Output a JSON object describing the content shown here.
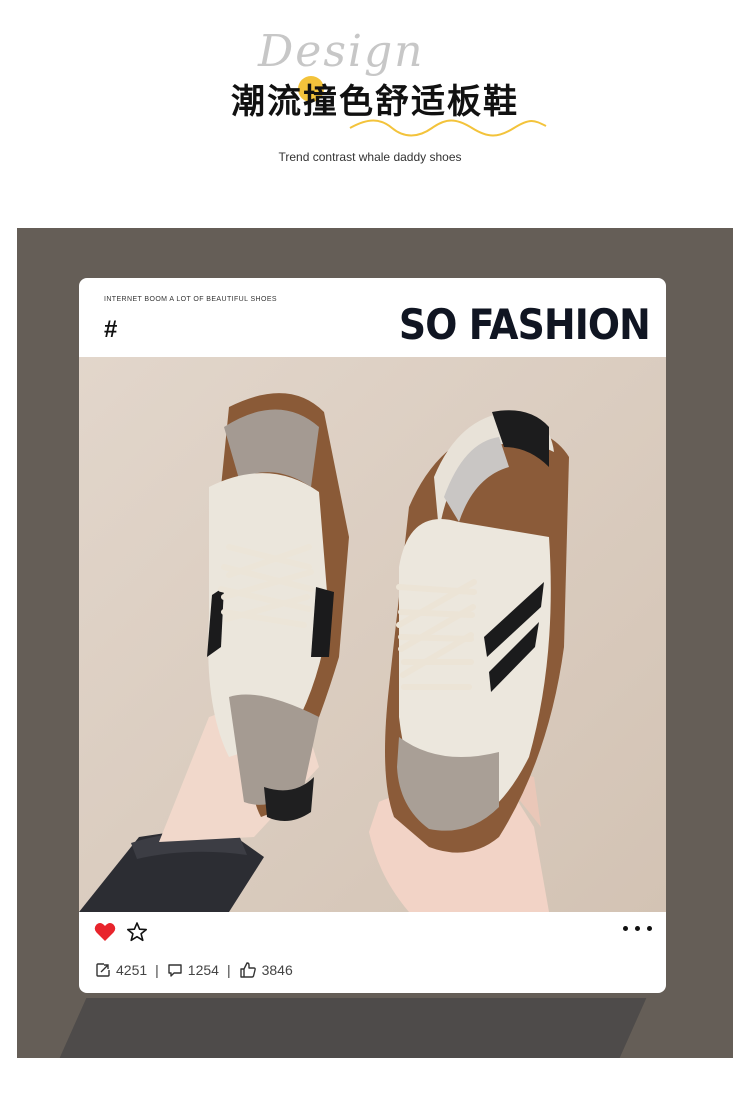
{
  "header": {
    "script_word": "Design",
    "title_cn": "潮流撞色舒适板鞋",
    "subtitle": "Trend contrast whale daddy shoes"
  },
  "card": {
    "tagline": "INTERNET BOOM A LOT OF BEAUTIFUL SHOES",
    "hash": "#",
    "headline": "SO FASHION"
  },
  "actions": {
    "share_count": "4251",
    "comment_count": "1254",
    "like_count": "3846",
    "separator": "|"
  },
  "icons": {
    "heart": "heart-icon",
    "star": "star-icon",
    "more": "more-dots-icon",
    "share": "share-icon",
    "comment": "comment-icon",
    "like": "thumbs-up-icon"
  },
  "colors": {
    "panel": "#655e57",
    "heart": "#e8242c",
    "accent_yellow": "#f3c33b",
    "headline": "#101522"
  }
}
